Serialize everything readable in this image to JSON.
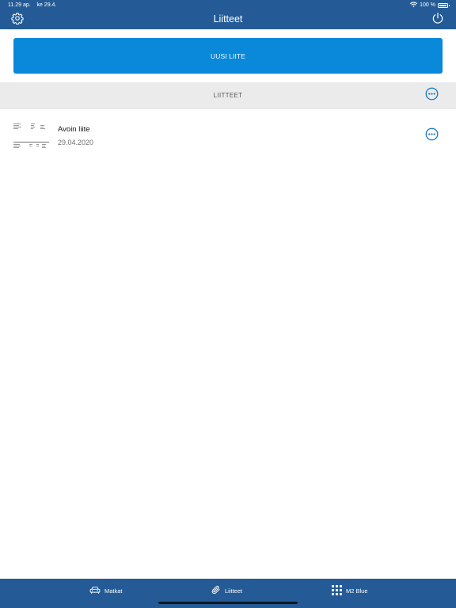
{
  "status_bar": {
    "time": "11.29 ap.",
    "date": "ke 29.4.",
    "battery_percent": "100 %"
  },
  "nav_bar": {
    "title": "Liitteet",
    "left_icon": "gear-icon",
    "right_icon": "power-icon"
  },
  "actions": {
    "new_attachment_label": "UUSI LIITE"
  },
  "section": {
    "title": "LIITTEET",
    "more_icon": "ellipsis-circle-icon"
  },
  "attachments": [
    {
      "title": "Avoin liite",
      "date": "29.04.2020",
      "more_icon": "ellipsis-circle-icon"
    }
  ],
  "tab_bar": {
    "tabs": [
      {
        "label": "Matkat",
        "icon": "car-icon",
        "selected": false
      },
      {
        "label": "Liitteet",
        "icon": "paperclip-icon",
        "selected": true
      },
      {
        "label": "M2 Blue",
        "icon": "grid-icon",
        "selected": false
      }
    ]
  },
  "colors": {
    "bar_blue": "#245b96",
    "button_blue": "#0a88d9",
    "section_gray": "#ebebeb",
    "accent_blue": "#1478c8"
  }
}
